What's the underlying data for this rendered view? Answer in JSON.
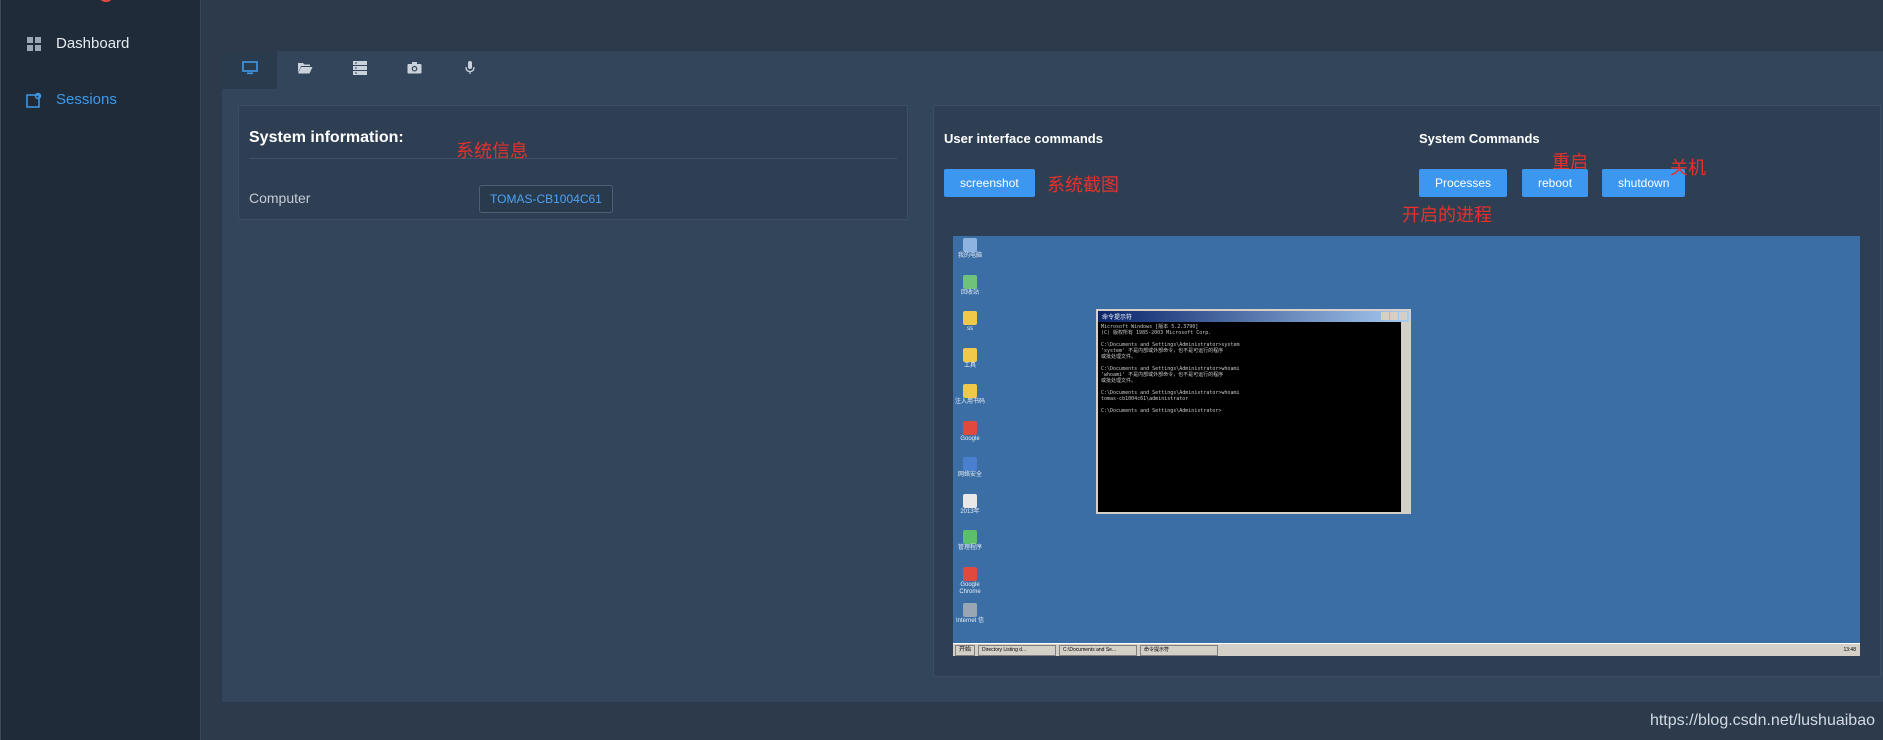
{
  "sidebar": {
    "items": [
      {
        "label": "Dashboard",
        "icon": "grid-icon"
      },
      {
        "label": "Sessions",
        "icon": "session-icon"
      }
    ]
  },
  "tabs": [
    {
      "icon": "monitor-icon",
      "active": true
    },
    {
      "icon": "folder-open-icon",
      "active": false
    },
    {
      "icon": "server-icon",
      "active": false
    },
    {
      "icon": "camera-icon",
      "active": false
    },
    {
      "icon": "microphone-icon",
      "active": false
    }
  ],
  "system_info": {
    "title": "System information:",
    "computer_label": "Computer",
    "computer_value": "TOMAS-CB1004C61"
  },
  "ui_commands": {
    "heading": "User interface commands",
    "screenshot_label": "screenshot"
  },
  "system_commands": {
    "heading": "System Commands",
    "processes_label": "Processes",
    "reboot_label": "reboot",
    "shutdown_label": "shutdown"
  },
  "annotations": {
    "system_info": "系统信息",
    "screenshot": "系统截图",
    "processes": "开启的进程",
    "reboot": "重启",
    "shutdown": "关机"
  },
  "preview": {
    "window_title": "命令提示符",
    "console_lines": [
      "Microsoft Windows [版本 5.2.3790]",
      "(C) 版权所有 1985-2003 Microsoft Corp.",
      "",
      "C:\\Documents and Settings\\Administrator>system",
      "'system' 不是内部或外部命令，也不是可运行的程序",
      "或批处理文件。",
      "",
      "C:\\Documents and Settings\\Administrator>whoami",
      "'whoami' 不是内部或外部命令，也不是可运行的程序",
      "或批处理文件。",
      "",
      "C:\\Documents and Settings\\Administrator>whoami",
      "tomas-cb1004c61\\administrator",
      "",
      "C:\\Documents and Settings\\Administrator>"
    ],
    "desktop_icons": [
      "我的电脑",
      "回收站",
      "ss",
      "工具",
      "注入用书码",
      "Google",
      "网络安全",
      "2013年",
      "管理程序",
      "Google Chrome",
      "Internet 信"
    ],
    "taskbar": {
      "start": "开始",
      "items": [
        "Directory Listing d...",
        "C:\\Documents and Se...",
        "命令提示符"
      ],
      "clock": "13:48"
    }
  },
  "watermark": "https://blog.csdn.net/lushuaibao",
  "colors": {
    "accent": "#3b97ef",
    "annotation": "#e8302a",
    "background": "#2c3a4c"
  }
}
